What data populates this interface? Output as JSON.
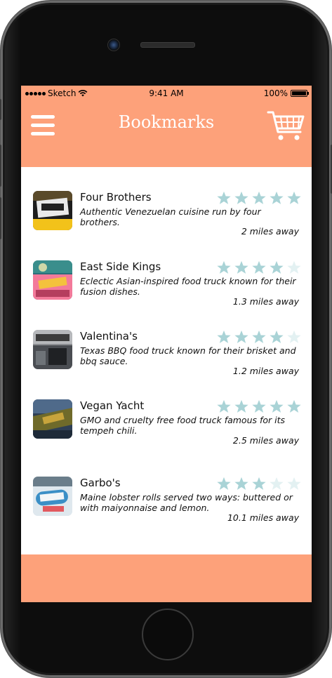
{
  "status_bar": {
    "carrier": "Sketch",
    "time": "9:41 AM",
    "battery": "100%"
  },
  "header": {
    "title": "Bookmarks",
    "menu_icon": "hamburger-menu-icon",
    "cart_icon": "cart-icon"
  },
  "colors": {
    "accent": "#FDA17A",
    "star_filled": "#A9D3D6",
    "star_empty": "#E3F1F2"
  },
  "bookmarks": [
    {
      "name": "Four Brothers",
      "description": "Authentic Venezuelan cuisine run by four brothers.",
      "distance": "2 miles away",
      "rating": 5
    },
    {
      "name": "East Side Kings",
      "description": "Eclectic Asian-inspired food truck known for their fusion dishes.",
      "distance": "1.3 miles away",
      "rating": 4
    },
    {
      "name": "Valentina's",
      "description": "Texas BBQ food truck known for their brisket and bbq sauce.",
      "distance": "1.2 miles away",
      "rating": 4
    },
    {
      "name": "Vegan Yacht",
      "description": "GMO and cruelty free food truck famous for its tempeh chili.",
      "distance": "2.5 miles away",
      "rating": 5
    },
    {
      "name": "Garbo's",
      "description": "Maine lobster rolls served two ways: buttered or with maiyonnaise and lemon.",
      "distance": "10.1 miles away",
      "rating": 3
    }
  ]
}
